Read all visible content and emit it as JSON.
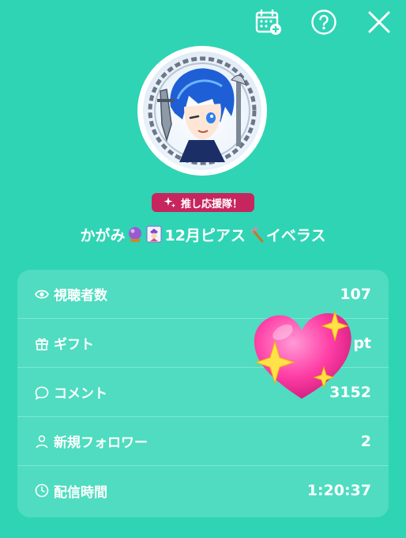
{
  "topbar": {
    "icons": [
      "calendar-add-icon",
      "help-icon",
      "close-icon"
    ]
  },
  "profile": {
    "avatar_text": "かがみ ピアス",
    "badge_label": "推し応援隊！",
    "name_part1": "かがみ",
    "name_part2": "12月ピアス",
    "name_part3": "イベラス"
  },
  "stats": [
    {
      "icon": "eye-icon",
      "label": "視聴者数",
      "value": "107"
    },
    {
      "icon": "gift-icon",
      "label": "ギフト",
      "value": "pt"
    },
    {
      "icon": "comment-icon",
      "label": "コメント",
      "value": "3152"
    },
    {
      "icon": "person-icon",
      "label": "新規フォロワー",
      "value": "2"
    },
    {
      "icon": "clock-icon",
      "label": "配信時間",
      "value": "1:20:37"
    }
  ],
  "colors": {
    "background": "#2fd4b4",
    "card": "#4fdcc0",
    "badge": "#c6265d"
  }
}
